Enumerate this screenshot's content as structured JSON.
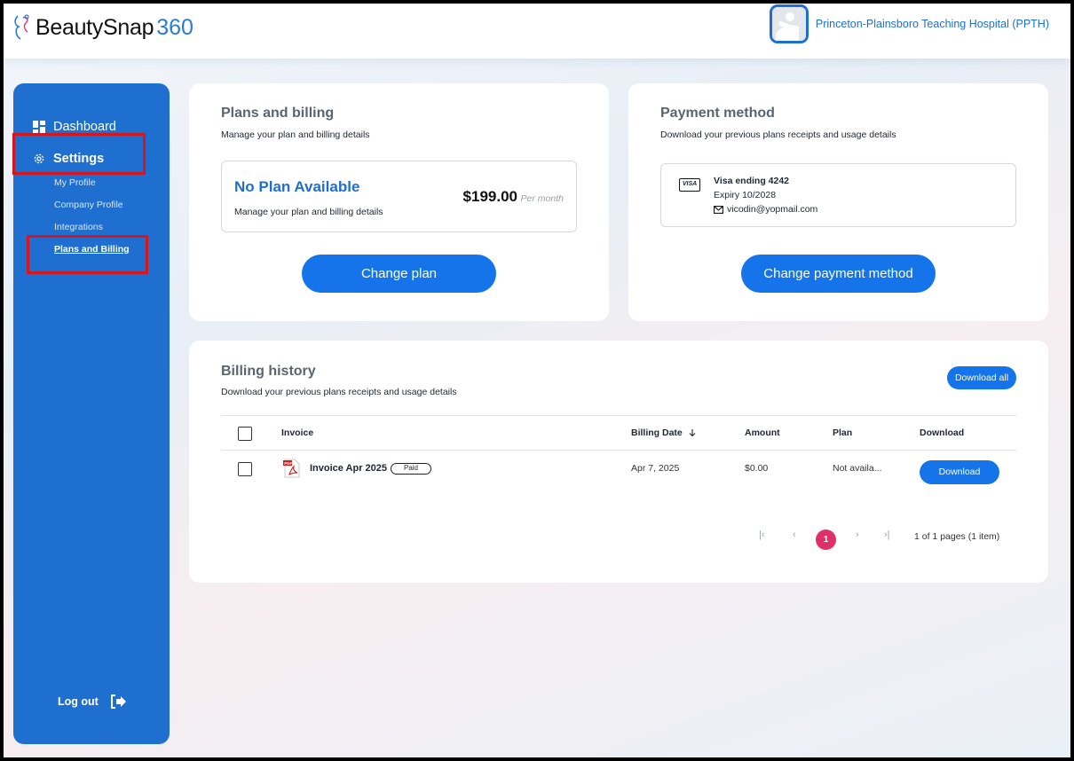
{
  "app": {
    "logo_text": "BeautySnap",
    "logo_number": "360",
    "org_name": "Princeton-Plainsboro Teaching Hospital (PPTH)"
  },
  "sidebar": {
    "dashboard": "Dashboard",
    "settings": "Settings",
    "items": [
      "My Profile",
      "Company Profile",
      "Integrations",
      "Plans and Billing"
    ],
    "logout": "Log out"
  },
  "plans": {
    "title": "Plans and billing",
    "subtitle": "Manage your plan and billing details",
    "plan_name": "No Plan Available",
    "plan_desc": "Manage your plan and billing details",
    "price": "$199.00",
    "per": "Per month",
    "button": "Change plan"
  },
  "payment": {
    "title": "Payment method",
    "subtitle": "Download your previous plans receipts and usage details",
    "card_brand": "VISA",
    "card_title": "Visa ending 4242",
    "expiry": "Expiry 10/2028",
    "email": "vicodin@yopmail.com",
    "button": "Change payment method"
  },
  "history": {
    "title": "Billing history",
    "subtitle": "Download your previous plans receipts and usage details",
    "download_all": "Download all",
    "columns": {
      "invoice": "Invoice",
      "billing_date": "Billing Date",
      "amount": "Amount",
      "plan": "Plan",
      "download": "Download"
    },
    "rows": [
      {
        "invoice": "Invoice Apr 2025",
        "status": "Paid",
        "date": "Apr 7, 2025",
        "amount": "$0.00",
        "plan": "Not availa...",
        "download": "Download"
      }
    ],
    "pagination": {
      "current_page": "1",
      "info": "1 of 1 pages (1 item)"
    }
  },
  "colors": {
    "primary": "#1574ea",
    "sidebar": "#1f6fd1",
    "highlight": "#d6161f",
    "page_current": "#e0306a"
  }
}
